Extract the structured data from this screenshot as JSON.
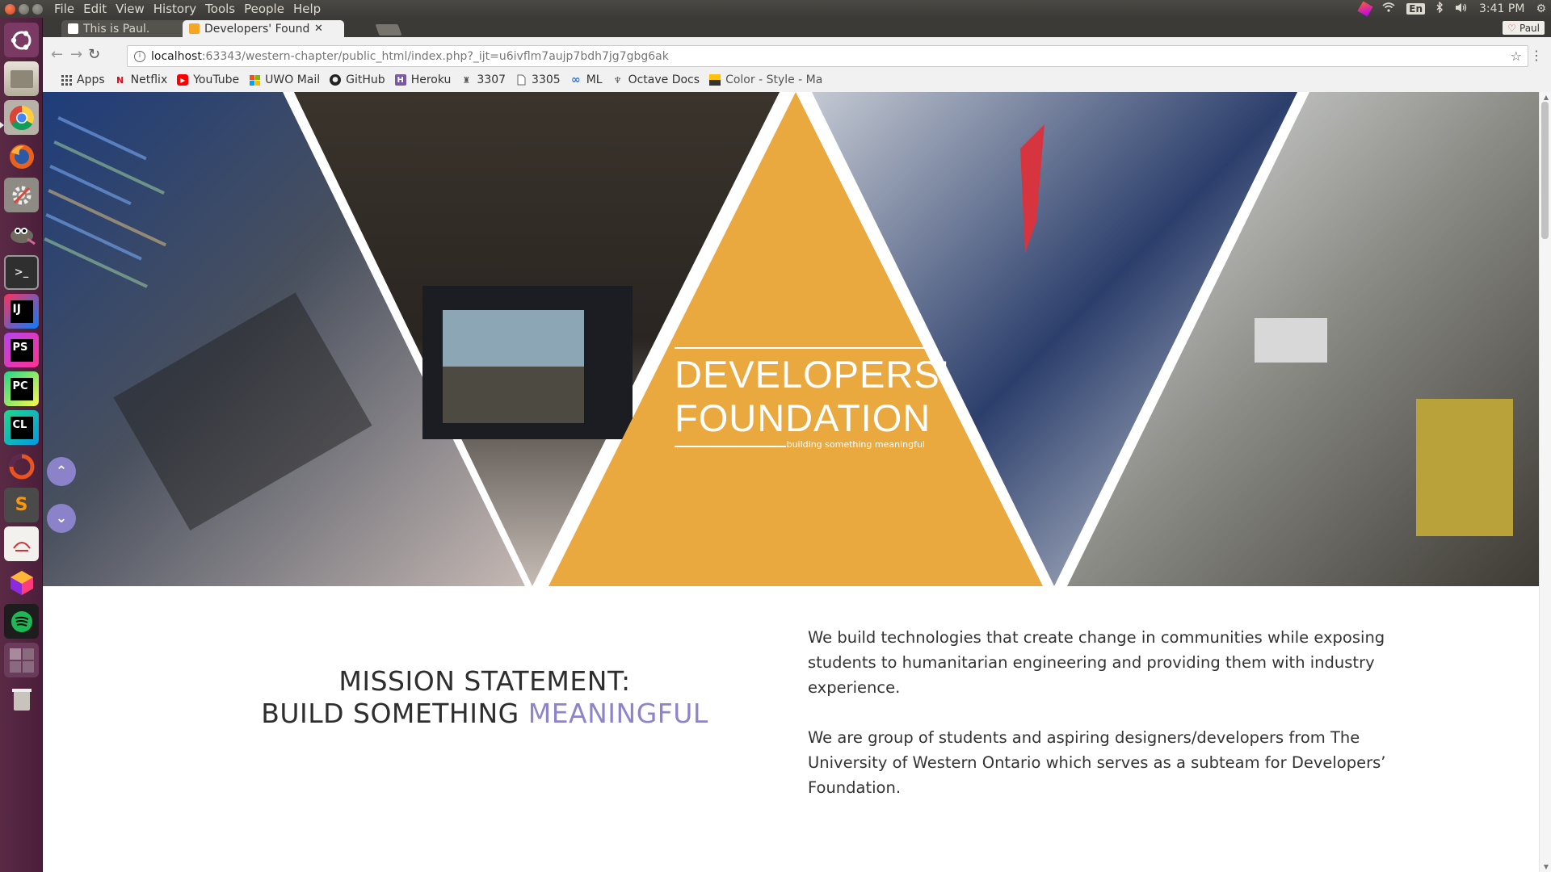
{
  "topbar": {
    "menus": [
      "File",
      "Edit",
      "View",
      "History",
      "Tools",
      "People",
      "Help"
    ],
    "lang": "En",
    "time": "3:41 PM"
  },
  "launcher": {
    "items": [
      "ubuntu-dash",
      "files",
      "chrome",
      "firefox",
      "system-settings",
      "gimp",
      "terminal",
      "intellij",
      "phpstorm",
      "pycharm",
      "clion",
      "ubuntu-software",
      "sublime-text",
      "evince",
      "gitkraken",
      "spotify",
      "workspaces",
      "trash"
    ]
  },
  "browser": {
    "tabs": [
      {
        "label": "This is Paul."
      },
      {
        "label": "Developers' Found"
      }
    ],
    "profile_name": "Paul",
    "url_host": "localhost",
    "url_rest": ":63343/western-chapter/public_html/index.php?_ijt=u6ivflm7aujp7bdh7jg7gbg6ak",
    "bookmarks": [
      {
        "label": "Apps"
      },
      {
        "label": "Netflix"
      },
      {
        "label": "YouTube"
      },
      {
        "label": "UWO Mail"
      },
      {
        "label": "GitHub"
      },
      {
        "label": "Heroku"
      },
      {
        "label": "3307"
      },
      {
        "label": "3305"
      },
      {
        "label": "ML"
      },
      {
        "label": "Octave Docs"
      },
      {
        "label": "Color - Style - Ma"
      }
    ]
  },
  "hero": {
    "title_line1": "DEVELOPERS’",
    "title_line2": "FOUNDATION",
    "tagline": "building something meaningful"
  },
  "mission": {
    "line1": "MISSION STATEMENT:",
    "line2_prefix": "BUILD SOMETHING",
    "line2_accent": "MEANINGFUL"
  },
  "about": {
    "p1": "We build technologies that create change in communities while exposing students to humanitarian engineering and providing them with industry experience.",
    "p2": "We are group of students and aspiring designers/developers from The University of Western Ontario which serves as a subteam for Developers’ Foundation."
  },
  "colors": {
    "accent_purple": "#8f84c9",
    "triangle_orange": "#e9a93e",
    "ubuntu_launcher": "#4b1e3a"
  }
}
